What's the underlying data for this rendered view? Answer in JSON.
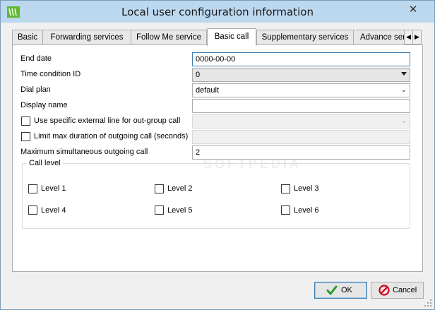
{
  "window": {
    "title": "Local user configuration information",
    "close_glyph": "✕"
  },
  "tabs": [
    {
      "label": "Basic",
      "active": false
    },
    {
      "label": "Forwarding services",
      "active": false
    },
    {
      "label": "Follow Me service",
      "active": false
    },
    {
      "label": "Basic call",
      "active": true
    },
    {
      "label": "Supplementary services",
      "active": false
    },
    {
      "label": "Advance ser",
      "active": false
    }
  ],
  "tab_scroll": {
    "left": "◀",
    "right": "▶"
  },
  "form": {
    "end_date": {
      "label": "End date",
      "value": "0000-00-00"
    },
    "time_condition": {
      "label": "Time condition ID",
      "value": "0"
    },
    "dial_plan": {
      "label": "Dial plan",
      "value": "default"
    },
    "display_name": {
      "label": "Display name",
      "value": ""
    },
    "external_line": {
      "label": "Use specific external line for out-group call",
      "checked": false,
      "value": ""
    },
    "limit_duration": {
      "label": "Limit max duration of outgoing call (seconds)",
      "checked": false,
      "value": ""
    },
    "max_simultaneous": {
      "label": "Maximum simultaneous outgoing call",
      "value": "2"
    }
  },
  "call_level": {
    "title": "Call level",
    "levels": [
      {
        "label": "Level 1",
        "checked": false
      },
      {
        "label": "Level 2",
        "checked": false
      },
      {
        "label": "Level 3",
        "checked": false
      },
      {
        "label": "Level 4",
        "checked": false
      },
      {
        "label": "Level 5",
        "checked": false
      },
      {
        "label": "Level 6",
        "checked": false
      }
    ]
  },
  "buttons": {
    "ok": "OK",
    "cancel": "Cancel"
  },
  "watermark": "SOFTPEDIA",
  "colors": {
    "titlebar": "#bcd8ef",
    "accent": "#3c7fb1",
    "ok_icon": "#2e9a2e",
    "cancel_icon": "#d0021b"
  }
}
